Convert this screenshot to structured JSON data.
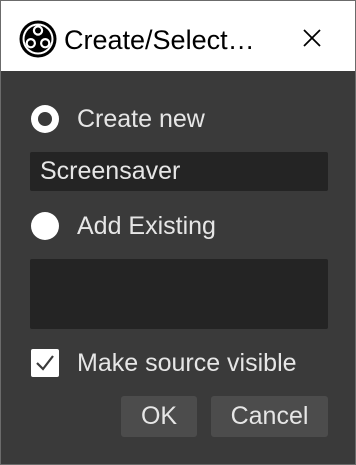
{
  "window": {
    "title": "Create/Select…",
    "icon": "obs-logo-icon",
    "close_icon": "close-icon"
  },
  "form": {
    "create_new_label": "Create new",
    "create_new_selected": true,
    "name_value": "Screensaver",
    "add_existing_label": "Add Existing",
    "add_existing_selected": false,
    "existing_items": [],
    "make_visible_label": "Make source visible",
    "make_visible_checked": true
  },
  "buttons": {
    "ok_label": "OK",
    "cancel_label": "Cancel"
  },
  "colors": {
    "background": "#3a3a3a",
    "input_background": "#242424",
    "button_background": "#4c4c4c",
    "text": "#e6e6e6"
  }
}
